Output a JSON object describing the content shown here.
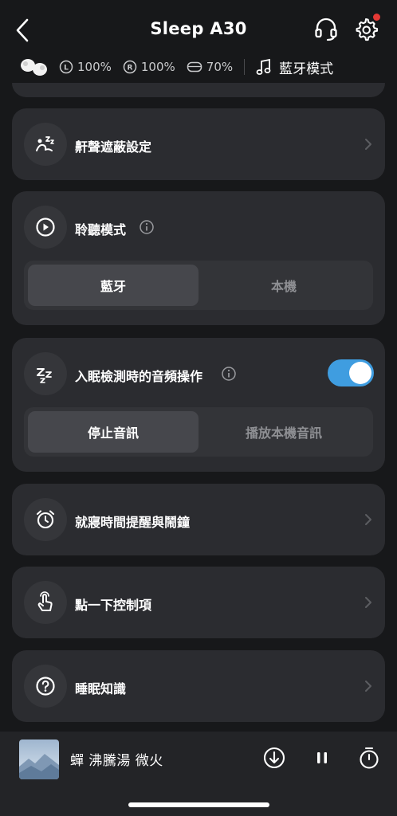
{
  "header": {
    "title": "Sleep A30",
    "back_icon": "chevron-left-icon",
    "support_icon": "headset-icon",
    "settings_icon": "gear-icon",
    "notification_color": "#e53935"
  },
  "status": {
    "left_battery": "100%",
    "right_battery": "100%",
    "case_battery": "70%",
    "left_glyph": "L",
    "right_glyph": "R",
    "mode": "藍牙模式"
  },
  "cards": {
    "snore": {
      "label": "鼾聲遮蔽設定",
      "icon": "snore-masking-icon"
    },
    "listen": {
      "label": "聆聽模式",
      "icon": "play-circle-icon",
      "options": [
        "藍牙",
        "本機"
      ],
      "selected": "藍牙"
    },
    "sleep_detect": {
      "label": "入眠檢測時的音頻操作",
      "icon": "zzz-icon",
      "toggle_on": true,
      "options": [
        "停止音訊",
        "播放本機音訊"
      ],
      "selected": "停止音訊"
    },
    "alarm": {
      "label": "就寢時間提醒與鬧鐘",
      "icon": "alarm-clock-icon"
    },
    "tap": {
      "label": "點一下控制項",
      "icon": "tap-hand-icon"
    },
    "knowledge": {
      "label": "睡眠知識",
      "icon": "question-circle-icon"
    }
  },
  "player": {
    "track": "蟬 沸騰湯 微火",
    "download_icon": "download-icon",
    "pause_icon": "pause-icon",
    "timer_icon": "timer-icon"
  },
  "colors": {
    "background": "#17181a",
    "card": "#2b2c30",
    "accent": "#3f9de0"
  }
}
